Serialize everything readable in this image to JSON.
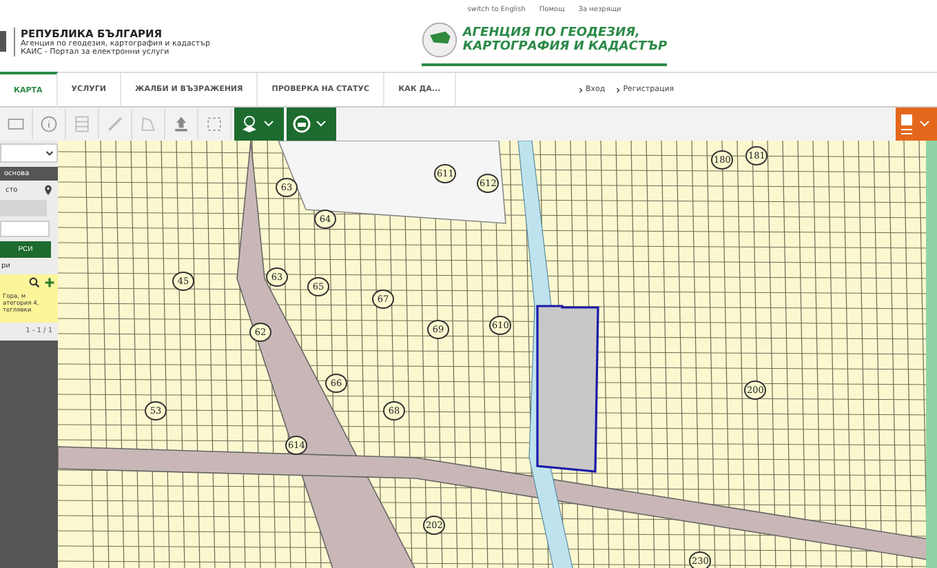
{
  "header": {
    "country": "РЕПУБЛИКА БЪЛГАРИЯ",
    "agency": "Агенция по геодезия, картография и кадастър",
    "portal": "КАИС - Портал за електронни услуги",
    "top_links": [
      "switch to English",
      "Помощ",
      "За незрящи"
    ],
    "logo_lines": [
      "АГЕНЦИЯ ПО ГЕОДЕЗИЯ,",
      "КАРТОГРАФИЯ И КАДАСТЪР"
    ]
  },
  "nav": {
    "tabs": [
      {
        "label": "КАРТА",
        "selected": true
      },
      {
        "label": "УСЛУГИ",
        "selected": false
      },
      {
        "label": "ЖАЛБИ И ВЪЗРАЖЕНИЯ",
        "selected": false
      },
      {
        "label": "ПРОВЕРКА НА СТАТУС",
        "selected": false
      },
      {
        "label": "КАК ДА...",
        "selected": false
      }
    ],
    "auth": [
      "Вход",
      "Регистрация"
    ]
  },
  "sidebar": {
    "header": "основа",
    "location_label": "сто",
    "search_button": "РСИ",
    "results_label": "ри",
    "result_lines": [
      "Гора, м",
      "атегория 4,",
      "теглявки"
    ],
    "pager": "1 - 1 / 1"
  },
  "map": {
    "parcels": [
      "63",
      "64",
      "611",
      "612",
      "180",
      "181",
      "45",
      "63",
      "65",
      "67",
      "62",
      "69",
      "610",
      "66",
      "53",
      "68",
      "200",
      "614",
      "202",
      "230"
    ]
  }
}
